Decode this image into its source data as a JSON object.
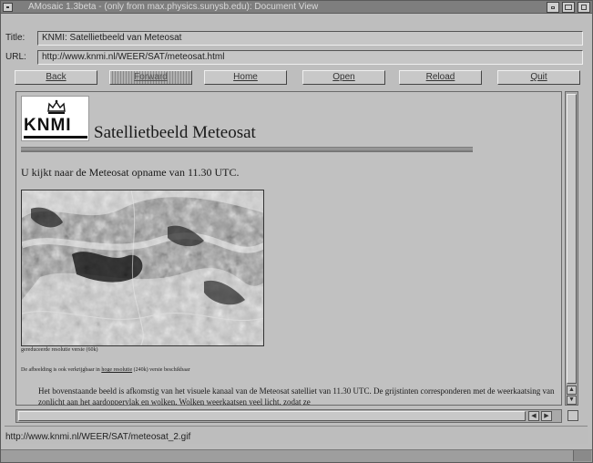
{
  "window": {
    "title": "AMosaic 1.3beta - (only from max.physics.sunysb.edu): Document View"
  },
  "fields": {
    "title_label": "Title:",
    "title_value": "KNMI: Satellietbeeld van Meteosat",
    "url_label": "URL:",
    "url_value": "http://www.knmi.nl/WEER/SAT/meteosat.html"
  },
  "nav": {
    "back": "Back",
    "forward": "Forward",
    "home": "Home",
    "open": "Open",
    "reload": "Reload",
    "quit": "Quit"
  },
  "page": {
    "logo_text": "KNMI",
    "title": "Satellietbeeld Meteosat",
    "intro": "U kijkt naar de Meteosat opname van 11.30 UTC.",
    "caption": "gereduceerde resolutie versie (60k)",
    "note_pre": "De afbeelding is ook verkrijgbaar in ",
    "note_link": "hoge resolutie",
    "note_post": " (240k) versie beschikbaar",
    "paragraph": "Het bovenstaande beeld is afkomstig van het visuele kanaal van de Meteosat satelliet van 11.30 UTC. De grijstinten corresponderen met de weerkaatsing van zonlicht aan het aardoppervlak en wolken. Wolken weerkaatsen veel licht, zodat ze"
  },
  "status": {
    "text": "http://www.knmi.nl/WEER/SAT/meteosat_2.gif"
  }
}
